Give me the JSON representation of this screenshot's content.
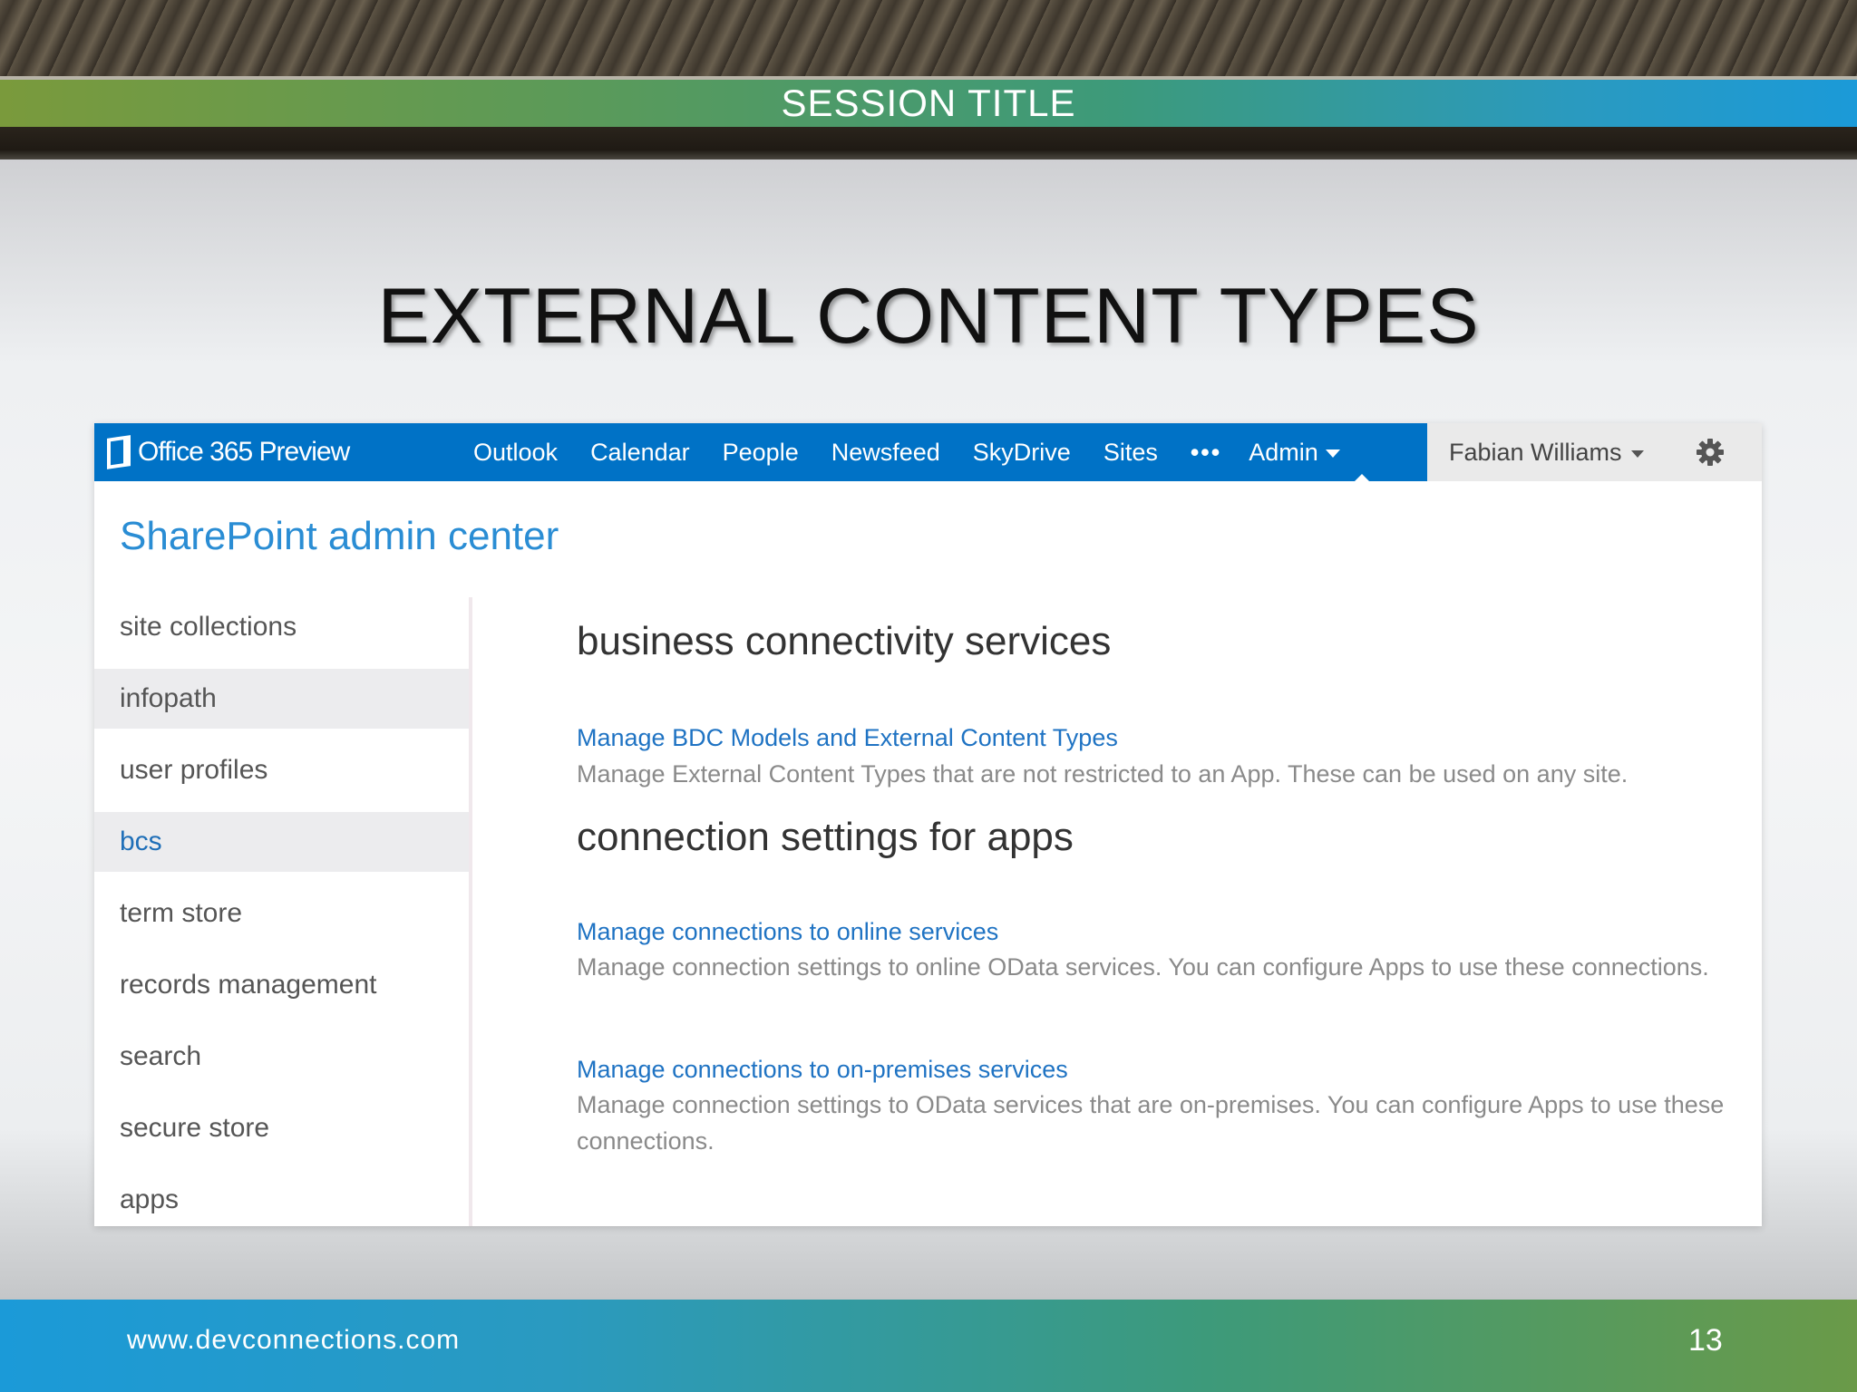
{
  "slide": {
    "session_title": "SESSION TITLE",
    "heading": "EXTERNAL CONTENT TYPES",
    "footer_url": "www.devconnections.com",
    "page_number": "13"
  },
  "suite_bar": {
    "brand": "Office 365 Preview",
    "brand_icon": "office-logo-icon",
    "nav": [
      "Outlook",
      "Calendar",
      "People",
      "Newsfeed",
      "SkyDrive",
      "Sites"
    ],
    "more": "•••",
    "admin": "Admin",
    "user": "Fabian Williams",
    "settings_icon": "gear-icon",
    "accent": "#0072c6"
  },
  "page": {
    "title": "SharePoint admin center"
  },
  "sidebar": {
    "items": [
      {
        "label": "site collections"
      },
      {
        "label": "infopath"
      },
      {
        "label": "user profiles"
      },
      {
        "label": "bcs"
      },
      {
        "label": "term store"
      },
      {
        "label": "records management"
      },
      {
        "label": "search"
      },
      {
        "label": "secure store"
      },
      {
        "label": "apps"
      }
    ],
    "active": "bcs"
  },
  "content": {
    "section1": {
      "title": "business connectivity services",
      "link": "Manage BDC Models and External Content Types",
      "desc": "Manage External Content Types that are not restricted to an App. These can be used on any site."
    },
    "section2": {
      "title": "connection settings for apps",
      "link1": "Manage connections to online services",
      "desc1": "Manage connection settings to online OData services. You can configure Apps to use these connections.",
      "link2": "Manage connections to on-premises services",
      "desc2": "Manage connection settings to OData services that are on-premises. You can configure Apps to use these connections."
    }
  }
}
